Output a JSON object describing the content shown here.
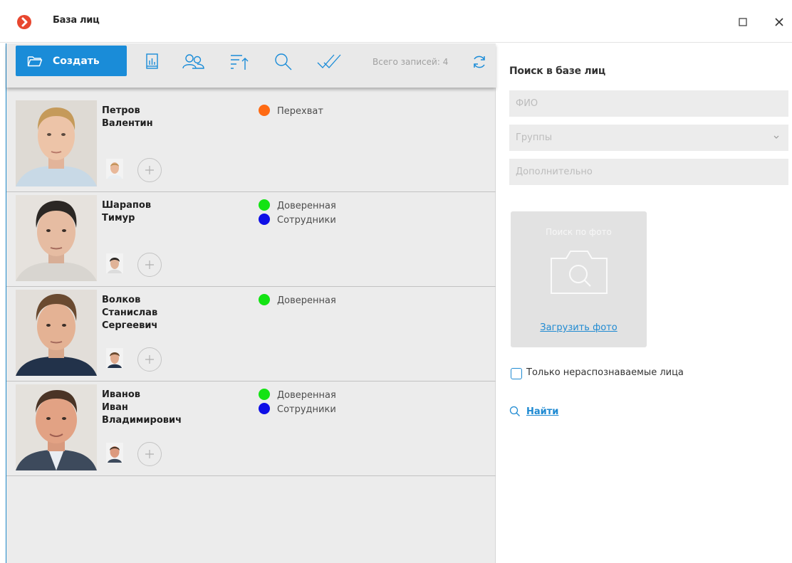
{
  "window": {
    "title": "База лиц"
  },
  "toolbar": {
    "create_label": "Создать",
    "total_text": "Всего записей: 4"
  },
  "colors": {
    "accent": "#1a8cd8",
    "interception": "#ff6a13",
    "trusted": "#13e313",
    "employees": "#0f0fe6"
  },
  "persons": [
    {
      "name_lines": [
        "Петров",
        "Валентин"
      ],
      "groups": [
        {
          "label": "Перехват",
          "color": "#ff6a13"
        }
      ]
    },
    {
      "name_lines": [
        "Шарапов",
        "Тимур"
      ],
      "groups": [
        {
          "label": "Доверенная",
          "color": "#13e313"
        },
        {
          "label": "Сотрудники",
          "color": "#0f0fe6"
        }
      ]
    },
    {
      "name_lines": [
        "Волков",
        "Станислав",
        "Сергеевич"
      ],
      "groups": [
        {
          "label": "Доверенная",
          "color": "#13e313"
        }
      ]
    },
    {
      "name_lines": [
        "Иванов",
        "Иван",
        "Владимирович"
      ],
      "groups": [
        {
          "label": "Доверенная",
          "color": "#13e313"
        },
        {
          "label": "Сотрудники",
          "color": "#0f0fe6"
        }
      ]
    }
  ],
  "search": {
    "title": "Поиск в базе лиц",
    "fio_placeholder": "ФИО",
    "groups_placeholder": "Группы",
    "extra_placeholder": "Дополнительно",
    "photo_search_label": "Поиск по фото",
    "upload_label": "Загрузить фото",
    "only_unrecognized_label": "Только нераспознаваемые лица",
    "find_label": "Найти"
  }
}
